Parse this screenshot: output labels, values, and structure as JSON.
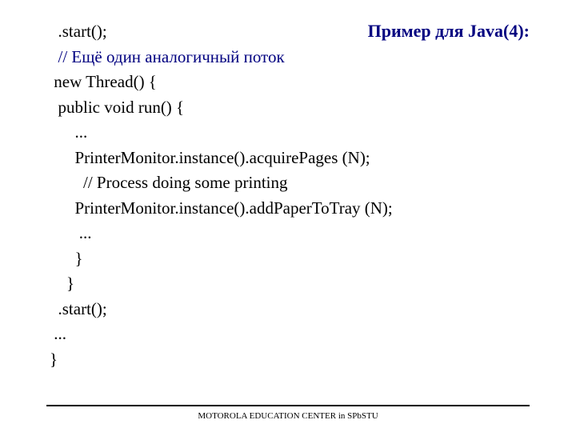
{
  "title": "Пример для Java(4):",
  "code": {
    "l01": "  .start();",
    "l02_comment": "  // Ещё один аналогичный поток",
    "l03": " new Thread() {",
    "l04": "  public void run() {",
    "l05": "      ...",
    "l06": "      PrinterMonitor.instance().acquirePages (N);",
    "l07": "        // Process doing some printing",
    "l08": "      PrinterMonitor.instance().addPaperToTray (N);",
    "l09": "       ...",
    "l10": "      }",
    "l11": "    }",
    "l12": "  .start();",
    "l13": " ...",
    "l14": "}"
  },
  "footer": "MOTOROLA EDUCATION CENTER in SPbSTU"
}
